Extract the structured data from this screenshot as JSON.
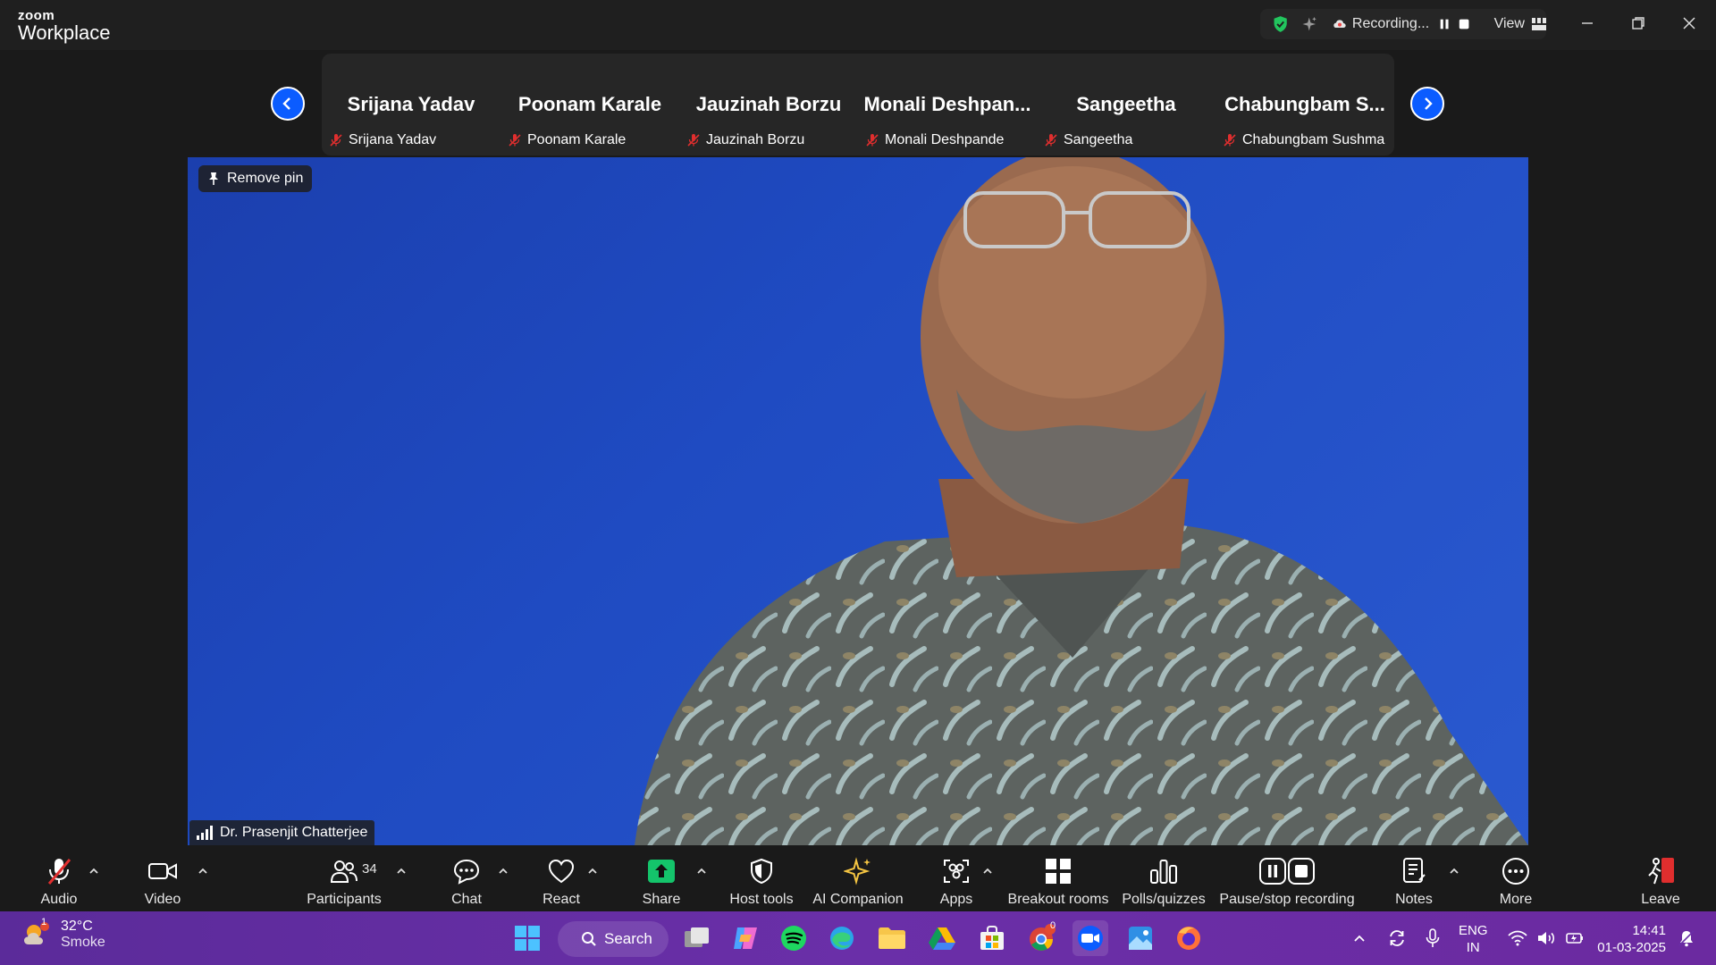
{
  "window": {
    "brand_top": "zoom",
    "brand_bottom": "Workplace",
    "recording_label": "Recording...",
    "view_label": "View"
  },
  "participants_strip": [
    {
      "display_name": "Srijana Yadav",
      "label": "Srijana Yadav"
    },
    {
      "display_name": "Poonam  Karale",
      "label": "Poonam  Karale"
    },
    {
      "display_name": "Jauzinah Borzu",
      "label": "Jauzinah Borzu"
    },
    {
      "display_name": "Monali  Deshpan...",
      "label": "Monali Deshpande"
    },
    {
      "display_name": "Sangeetha",
      "label": "Sangeetha"
    },
    {
      "display_name": "Chabungbam  S...",
      "label": "Chabungbam Sushma"
    }
  ],
  "main_video": {
    "remove_pin_label": "Remove pin",
    "speaker_name": "Dr. Prasenjit Chatterjee"
  },
  "toolbar": {
    "audio": "Audio",
    "video": "Video",
    "participants": "Participants",
    "participants_count": "34",
    "chat": "Chat",
    "react": "React",
    "share": "Share",
    "host_tools": "Host tools",
    "ai_companion": "AI Companion",
    "apps": "Apps",
    "breakout_rooms": "Breakout rooms",
    "polls": "Polls/quizzes",
    "pause_stop": "Pause/stop recording",
    "notes": "Notes",
    "more": "More",
    "leave": "Leave"
  },
  "taskbar": {
    "weather_temp": "32°C",
    "weather_desc": "Smoke",
    "weather_badge": "1",
    "search_label": "Search",
    "chrome_badge": "0",
    "lang_top": "ENG",
    "lang_bottom": "IN",
    "time": "14:41",
    "date": "01-03-2025"
  },
  "colors": {
    "accent_blue": "#0b5cff",
    "share_green": "#14c46b",
    "leave_red": "#e02e2e",
    "ai_gold": "#f5c542"
  }
}
